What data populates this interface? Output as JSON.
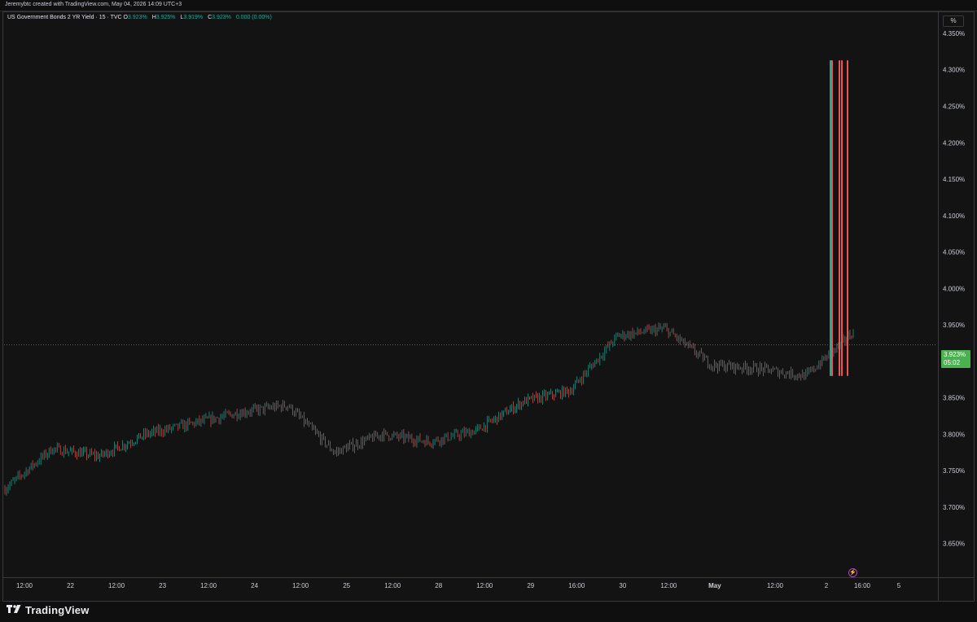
{
  "attribution": "Jeremybtc created with TradingView.com, May 04, 2026 14:09 UTC+3",
  "symbol": {
    "title": "US Government Bonds 2 YR Yield · 15 · TVC",
    "open_label": "O",
    "open": "3.923%",
    "high_label": "H",
    "high": "3.925%",
    "low_label": "L",
    "low": "3.919%",
    "close_label": "C",
    "close": "3.923%",
    "change": "0.000 (0.00%)"
  },
  "price_scale_unit": "%",
  "last_price": {
    "value": "3.923%",
    "countdown": "05:02",
    "color": "#4caf50"
  },
  "brand": "TradingView",
  "colors": {
    "up": "#26a69a",
    "down": "#ef5350",
    "background": "#131314",
    "text": "#d1d4dc"
  },
  "chart_data": {
    "type": "line",
    "ylabel": "",
    "y_axis_side": "right",
    "y_unit": "%",
    "ylim": [
      3.605,
      4.379
    ],
    "y_ticks": [
      3.65,
      3.7,
      3.75,
      3.8,
      3.85,
      3.9,
      3.95,
      4.0,
      4.05,
      4.1,
      4.15,
      4.2,
      4.25,
      4.3,
      4.35
    ],
    "y_tick_labels": [
      "3.650%",
      "3.700%",
      "3.750%",
      "3.800%",
      "3.850%",
      "3.900%",
      "3.950%",
      "4.000%",
      "4.050%",
      "4.100%",
      "4.150%",
      "4.200%",
      "4.250%",
      "4.300%",
      "4.350%"
    ],
    "x_tick_labels": [
      "12:00",
      "22",
      "12:00",
      "23",
      "12:00",
      "24",
      "12:00",
      "25",
      "12:00",
      "28",
      "12:00",
      "29",
      "16:00",
      "30",
      "12:00",
      "May",
      "12:00",
      "2",
      "16:00",
      "5"
    ],
    "x_tick_bold": [
      false,
      false,
      false,
      false,
      false,
      false,
      false,
      false,
      false,
      false,
      false,
      false,
      false,
      false,
      false,
      true,
      false,
      false,
      false,
      false
    ],
    "last_price_line": 3.923,
    "series": [
      {
        "x": [
          "21 12:00",
          "22 00:00",
          "22 12:00",
          "23 00:00",
          "23 12:00",
          "24 00:00",
          "24 12:00",
          "25 00:00",
          "25 12:00",
          "28 00:00",
          "28 12:00",
          "29 00:00",
          "29 16:00",
          "30 00:00",
          "30 12:00",
          "May 1 00:00",
          "1 12:00",
          "2 00:00",
          "2 16:00"
        ],
        "values": [
          3.725,
          3.78,
          3.77,
          3.8,
          3.815,
          3.83,
          3.84,
          3.775,
          3.8,
          3.79,
          3.805,
          3.845,
          3.86,
          3.935,
          3.945,
          3.895,
          3.89,
          3.88,
          3.94
        ]
      }
    ],
    "spike": {
      "high": 4.313,
      "low": 3.88
    }
  }
}
